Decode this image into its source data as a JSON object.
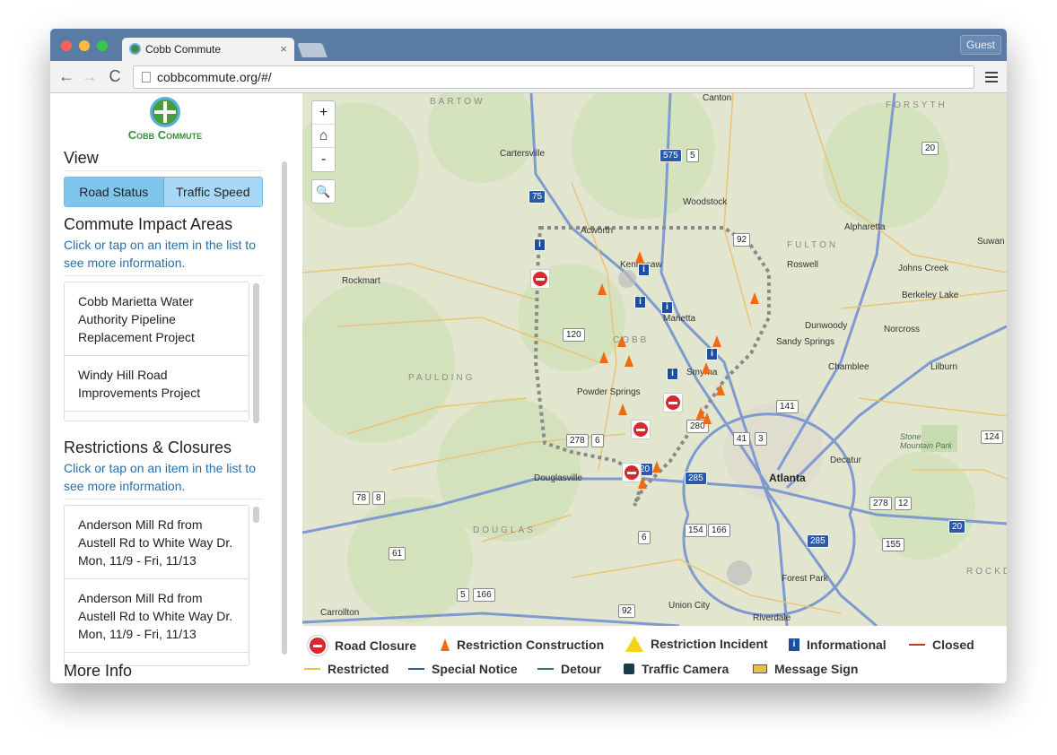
{
  "browser": {
    "tab_title": "Cobb Commute",
    "tab_close": "×",
    "url": "cobbcommute.org/#/",
    "guest_label": "Guest",
    "back": "←",
    "forward": "→",
    "reload": "C"
  },
  "sidebar": {
    "logo_text": "Cobb Commute",
    "view_title": "View",
    "view_buttons": [
      "Road Status",
      "Traffic Speed"
    ],
    "impact": {
      "title": "Commute Impact Areas",
      "subtitle": "Click or tap on an item in the list to see more information.",
      "items": [
        "Cobb Marietta Water Authority Pipeline Replacement Project",
        "Windy Hill Road Improvements Project"
      ]
    },
    "restrictions": {
      "title": "Restrictions & Closures",
      "subtitle": "Click or tap on an item in the list to see more information.",
      "items": [
        {
          "road": "Anderson Mill Rd from Austell Rd to White Way Dr.",
          "dates": "Mon, 11/9 - Fri, 11/13"
        },
        {
          "road": "Anderson Mill Rd from Austell Rd to White Way Dr.",
          "dates": "Mon, 11/9 - Fri, 11/13"
        }
      ]
    },
    "more_info": "More Info"
  },
  "map": {
    "zoom_in": "+",
    "home": "⌂",
    "zoom_out": "-",
    "search": "🔍",
    "regions": [
      "BARTOW",
      "FORSYTH",
      "FULTON",
      "PAULDING",
      "DOUGLAS",
      "COBB",
      "ROCKD"
    ],
    "places": [
      "Canton",
      "Cartersville",
      "Woodstock",
      "Alpharetta",
      "Roswell",
      "Johns Creek",
      "Berkeley Lake",
      "Suwan",
      "Rockmart",
      "Acworth",
      "Kennesaw",
      "Marietta",
      "Dunwoody",
      "Sandy Springs",
      "Norcross",
      "Smyrna",
      "Chamblee",
      "Lilburn",
      "Powder Springs",
      "Stone Mountain Park",
      "Decatur",
      "Atlanta",
      "Douglasville",
      "Forest Park",
      "Union City",
      "Riverdale",
      "Carrollton"
    ],
    "shields": [
      "575",
      "5",
      "20",
      "75",
      "92",
      "120",
      "278",
      "6",
      "20",
      "41",
      "3",
      "141",
      "124",
      "285",
      "280",
      "78",
      "8",
      "278",
      "12",
      "20",
      "285",
      "155",
      "154",
      "166",
      "6",
      "61",
      "5",
      "166",
      "92"
    ],
    "colors": {
      "closure": "#d7282f",
      "construction": "#f06a12",
      "informational": "#1e4ea0",
      "incident": "#f5d21a"
    }
  },
  "legend": {
    "items": [
      {
        "label": "Road Closure",
        "symbol": "closure-icon"
      },
      {
        "label": "Restriction Construction",
        "symbol": "cone-icon"
      },
      {
        "label": "Restriction Incident",
        "symbol": "warning-icon"
      },
      {
        "label": "Informational",
        "symbol": "info-icon"
      },
      {
        "label": "Closed",
        "symbol": "line-red",
        "color": "#c0392b"
      },
      {
        "label": "Restricted",
        "symbol": "line-yellow",
        "color": "#e8c43a"
      },
      {
        "label": "Special Notice",
        "symbol": "line-blue",
        "color": "#2c5e9e"
      },
      {
        "label": "Detour",
        "symbol": "line-green",
        "color": "#2e7d4f"
      },
      {
        "label": "Traffic Camera",
        "symbol": "camera-icon"
      },
      {
        "label": "Message Sign",
        "symbol": "sign-icon"
      }
    ]
  }
}
